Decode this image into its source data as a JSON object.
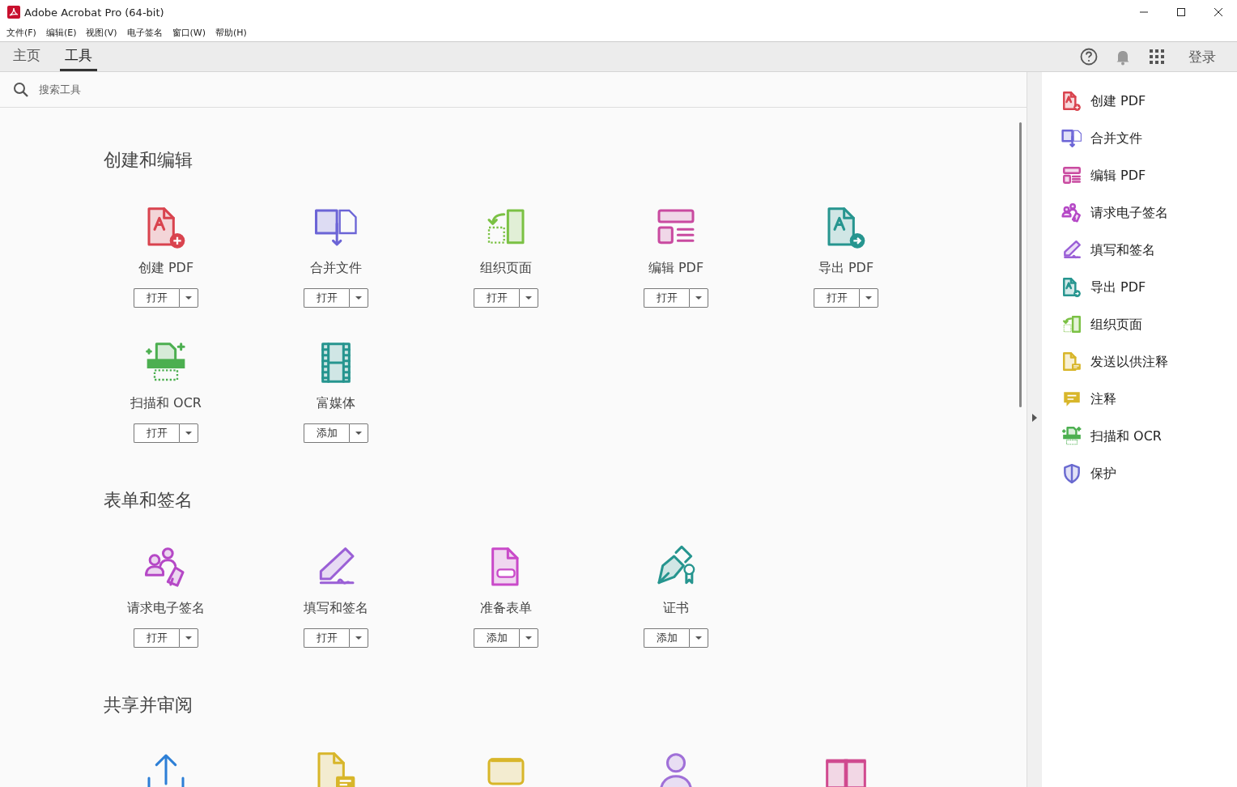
{
  "window": {
    "title": "Adobe Acrobat Pro (64-bit)"
  },
  "menu": [
    "文件(F)",
    "编辑(E)",
    "视图(V)",
    "电子签名",
    "窗口(W)",
    "帮助(H)"
  ],
  "tabs": [
    {
      "label": "主页",
      "selected": false
    },
    {
      "label": "工具",
      "selected": true
    }
  ],
  "sign_in": "登录",
  "search": {
    "placeholder": "搜索工具"
  },
  "sections": [
    {
      "title": "创建和编辑",
      "tools": [
        {
          "kind": "pdf-add",
          "color": "#d9434e",
          "label": "创建 PDF",
          "action": "打开"
        },
        {
          "kind": "combine",
          "color": "#6b64d6",
          "label": "合并文件",
          "action": "打开"
        },
        {
          "kind": "organize",
          "color": "#7bc144",
          "label": "组织页面",
          "action": "打开"
        },
        {
          "kind": "edit",
          "color": "#c94aa0",
          "label": "编辑 PDF",
          "action": "打开"
        },
        {
          "kind": "pdf-export",
          "color": "#26958f",
          "label": "导出 PDF",
          "action": "打开"
        },
        {
          "kind": "scan",
          "color": "#4caf50",
          "label": "扫描和 OCR",
          "action": "打开"
        },
        {
          "kind": "media",
          "color": "#26958f",
          "label": "富媒体",
          "action": "添加"
        }
      ]
    },
    {
      "title": "表单和签名",
      "tools": [
        {
          "kind": "people-pen",
          "color": "#b548c6",
          "label": "请求电子签名",
          "action": "打开"
        },
        {
          "kind": "sign",
          "color": "#9a5fd6",
          "label": "填写和签名",
          "action": "打开"
        },
        {
          "kind": "form",
          "color": "#c94ac9",
          "label": "准备表单",
          "action": "添加"
        },
        {
          "kind": "certificate",
          "color": "#26958f",
          "label": "证书",
          "action": "添加"
        }
      ]
    },
    {
      "title": "共享并审阅",
      "tools": [
        {
          "kind": "share",
          "color": "#2d7fd6"
        },
        {
          "kind": "comment-doc",
          "color": "#d8b62a"
        },
        {
          "kind": "stamp",
          "color": "#d8b62a"
        },
        {
          "kind": "person",
          "color": "#a070d8"
        },
        {
          "kind": "pages",
          "color": "#d04a8f"
        }
      ]
    }
  ],
  "sidebar": {
    "items": [
      {
        "kind": "pdf-add",
        "color": "#d9434e",
        "label": "创建 PDF"
      },
      {
        "kind": "combine",
        "color": "#6b64d6",
        "label": "合并文件"
      },
      {
        "kind": "edit",
        "color": "#c94aa0",
        "label": "编辑 PDF"
      },
      {
        "kind": "people-pen",
        "color": "#b548c6",
        "label": "请求电子签名"
      },
      {
        "kind": "sign",
        "color": "#9a5fd6",
        "label": "填写和签名"
      },
      {
        "kind": "pdf-export",
        "color": "#26958f",
        "label": "导出 PDF"
      },
      {
        "kind": "organize",
        "color": "#7bc144",
        "label": "组织页面"
      },
      {
        "kind": "comment-doc",
        "color": "#d8b62a",
        "label": "发送以供注释"
      },
      {
        "kind": "comment",
        "color": "#d8b62a",
        "label": "注释"
      },
      {
        "kind": "scan",
        "color": "#4caf50",
        "label": "扫描和 OCR"
      },
      {
        "kind": "shield",
        "color": "#6a6ad0",
        "label": "保护"
      }
    ]
  }
}
